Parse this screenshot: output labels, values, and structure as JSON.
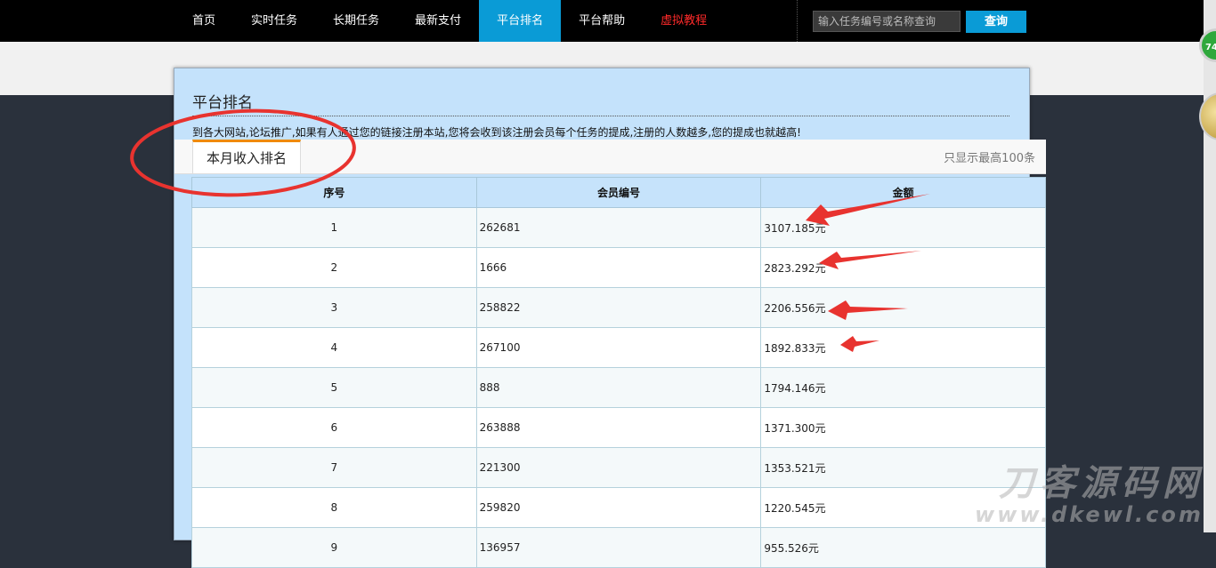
{
  "nav": {
    "items": [
      {
        "label": "首页"
      },
      {
        "label": "实时任务"
      },
      {
        "label": "长期任务"
      },
      {
        "label": "最新支付"
      },
      {
        "label": "平台排名"
      },
      {
        "label": "平台帮助"
      },
      {
        "label": "虚拟教程"
      }
    ],
    "active_index": 4
  },
  "search": {
    "placeholder": "输入任务编号或名称查询",
    "button": "查询"
  },
  "side_badge": {
    "number": "74"
  },
  "panel": {
    "title": "平台排名",
    "intro": "到各大网站,论坛推广,如果有人通过您的链接注册本站,您将会收到该注册会员每个任务的提成,注册的人数越多,您的提成也就越高!",
    "tab": "本月收入排名",
    "note": "只显示最高100条"
  },
  "table": {
    "headers": {
      "rank": "序号",
      "member": "会员编号",
      "amount": "金额"
    },
    "rows": [
      {
        "rank": "1",
        "member": "262681",
        "amount": "3107.185元"
      },
      {
        "rank": "2",
        "member": "1666",
        "amount": "2823.292元"
      },
      {
        "rank": "3",
        "member": "258822",
        "amount": "2206.556元"
      },
      {
        "rank": "4",
        "member": "267100",
        "amount": "1892.833元"
      },
      {
        "rank": "5",
        "member": "888",
        "amount": "1794.146元"
      },
      {
        "rank": "6",
        "member": "263888",
        "amount": "1371.300元"
      },
      {
        "rank": "7",
        "member": "221300",
        "amount": "1353.521元"
      },
      {
        "rank": "8",
        "member": "259820",
        "amount": "1220.545元"
      },
      {
        "rank": "9",
        "member": "136957",
        "amount": "955.526元"
      }
    ]
  },
  "watermark": {
    "line1": "刀客源码网",
    "line2": "www.dkewl.com"
  },
  "colors": {
    "accent": "#0a9bd6",
    "highlight": "#ff2a2a",
    "tab_accent": "#f08a00",
    "annotation": "#e8332f"
  }
}
